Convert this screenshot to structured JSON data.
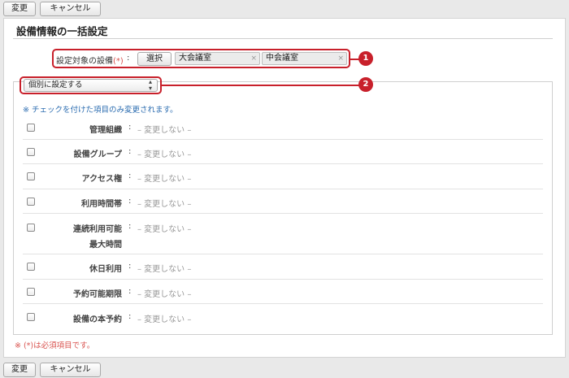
{
  "toolbar_top": {
    "change_label": "変更",
    "cancel_label": "キャンセル"
  },
  "toolbar_bottom": {
    "change_label": "変更",
    "cancel_label": "キャンセル"
  },
  "page_title": "設備情報の一括設定",
  "target": {
    "label": "設定対象の設備",
    "required_mark": "(*)",
    "colon": ":",
    "select_button": "選択",
    "chips": [
      {
        "label": "大会議室",
        "remove": "×"
      },
      {
        "label": "中会議室",
        "remove": "×"
      }
    ]
  },
  "mode_select": {
    "value": "個別に設定する",
    "arrows": "▲▼"
  },
  "callouts": [
    "1",
    "2"
  ],
  "notice": "※ チェックを付けた項目のみ変更されます。",
  "rows": [
    {
      "label": "管理組織",
      "sep": ":",
      "value": "– 変更しない –"
    },
    {
      "label": "設備グループ",
      "sep": ":",
      "value": "– 変更しない –"
    },
    {
      "label": "アクセス権",
      "sep": ":",
      "value": "– 変更しない –"
    },
    {
      "label": "利用時間帯",
      "sep": ":",
      "value": "– 変更しない –"
    },
    {
      "label": "連続利用可能",
      "label2": "最大時間",
      "sep": ":",
      "value": "– 変更しない –"
    },
    {
      "label": "休日利用",
      "sep": ":",
      "value": "– 変更しない –"
    },
    {
      "label": "予約可能期限",
      "sep": ":",
      "value": "– 変更しない –"
    },
    {
      "label": "設備の本予約",
      "sep": ":",
      "value": "– 変更しない –"
    }
  ],
  "required_note": "※ (*)は必須項目です。",
  "colors": {
    "callout": "#c8202b",
    "notice_blue": "#2b6cb0",
    "required_red": "#d9534f"
  }
}
